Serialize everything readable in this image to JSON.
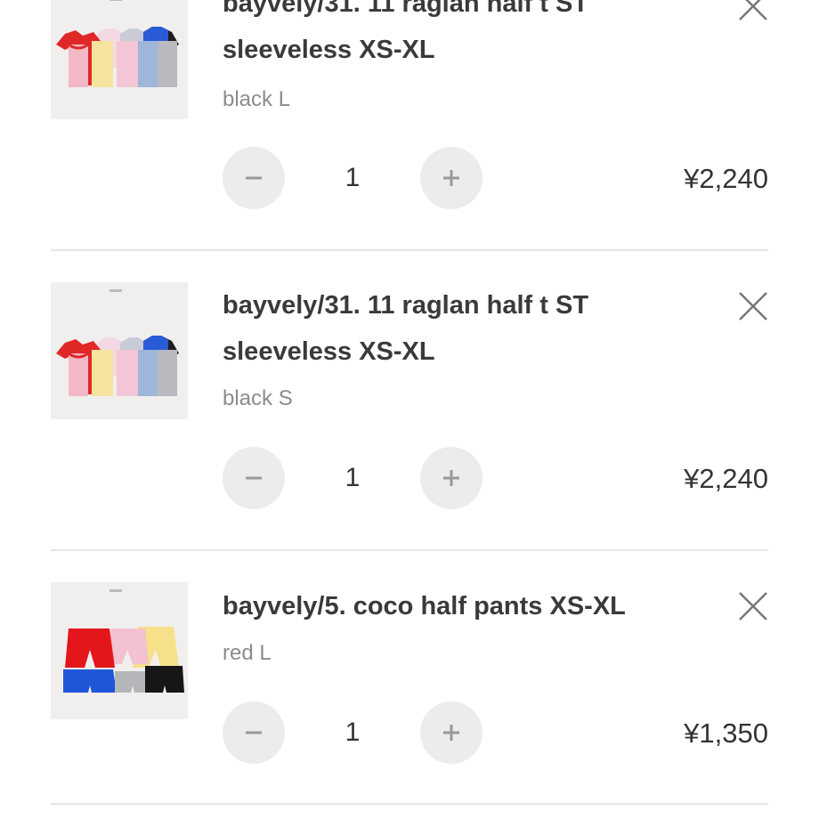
{
  "cart": {
    "items": [
      {
        "title_line1": "bayvely/31. 11 raglan half t ST",
        "title_line2": "sleeveless XS-XL",
        "variant": "black L",
        "quantity": "1",
        "price": "¥2,240",
        "thumbnail": "raglan-tshirts-photo"
      },
      {
        "title_line1": "bayvely/31. 11 raglan half t ST",
        "title_line2": "sleeveless XS-XL",
        "variant": "black S",
        "quantity": "1",
        "price": "¥2,240",
        "thumbnail": "raglan-tshirts-photo"
      },
      {
        "title_line1": "bayvely/5. coco half pants XS-XL",
        "variant": "red L",
        "quantity": "1",
        "price": "¥1,350",
        "thumbnail": "half-pants-photo"
      }
    ],
    "icons": {
      "remove": "close-icon",
      "decrease": "minus-icon",
      "increase": "plus-icon"
    },
    "colors": {
      "button_bg": "#ececec",
      "variant_text": "#8c8c8c",
      "divider": "#e6e6e6"
    }
  }
}
